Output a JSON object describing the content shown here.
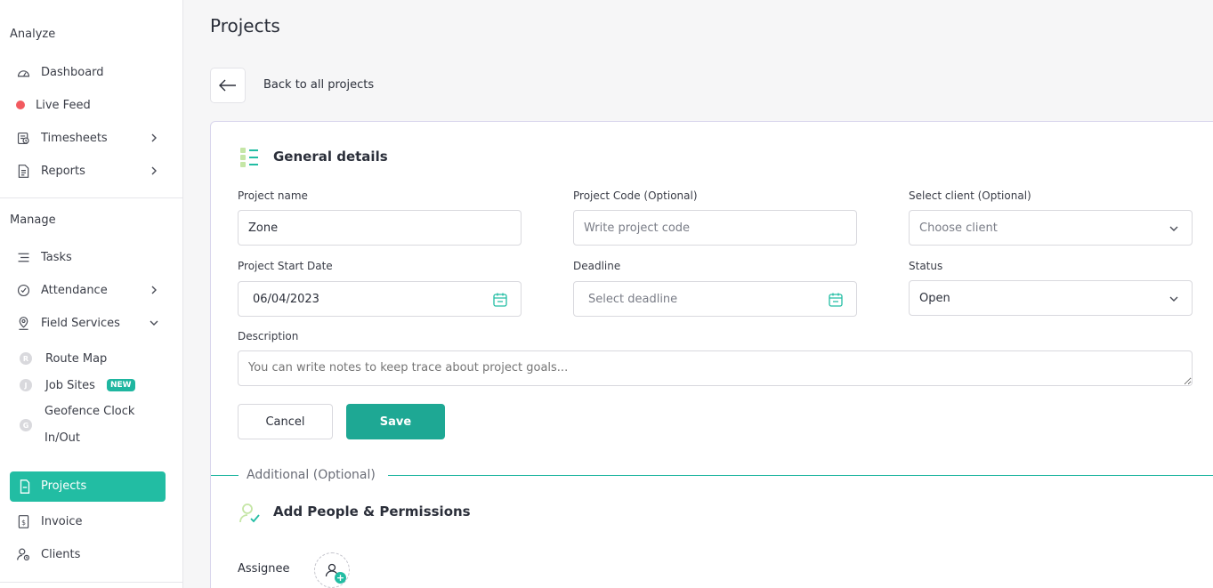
{
  "sidebar": {
    "analyze_title": "Analyze",
    "manage_title": "Manage",
    "analyze_items": [
      {
        "label": "Dashboard"
      },
      {
        "label": "Live Feed"
      },
      {
        "label": "Timesheets"
      },
      {
        "label": "Reports"
      }
    ],
    "manage_items": [
      {
        "label": "Tasks"
      },
      {
        "label": "Attendance"
      },
      {
        "label": "Field Services"
      }
    ],
    "field_services_sub": [
      {
        "letter": "R",
        "label": "Route Map"
      },
      {
        "letter": "J",
        "label": "Job Sites",
        "badge": "NEW"
      },
      {
        "letter": "G",
        "label": "Geofence Clock",
        "label2": "In/Out"
      }
    ],
    "active_item": "Projects",
    "bottom_items": [
      {
        "label": "Invoice"
      },
      {
        "label": "Clients"
      }
    ]
  },
  "page": {
    "title": "Projects",
    "back_label": "Back to all projects"
  },
  "general": {
    "heading": "General details",
    "project_name_label": "Project name",
    "project_name_value": "Zone",
    "project_code_label": "Project Code (Optional)",
    "project_code_placeholder": "Write project code",
    "client_label": "Select client (Optional)",
    "client_placeholder": "Choose client",
    "start_date_label": "Project Start Date",
    "start_date_value": "06/04/2023",
    "deadline_label": "Deadline",
    "deadline_placeholder": "Select deadline",
    "status_label": "Status",
    "status_value": "Open",
    "description_label": "Description",
    "description_placeholder": "You can write notes to keep trace about project goals...",
    "cancel_label": "Cancel",
    "save_label": "Save"
  },
  "additional": {
    "divider_label": "Additional (Optional)",
    "people_heading": "Add People & Permissions",
    "assignee_label": "Assignee"
  },
  "colors": {
    "accent": "#22bda3",
    "save": "#1ea894",
    "live_dot": "#f25a5f"
  }
}
